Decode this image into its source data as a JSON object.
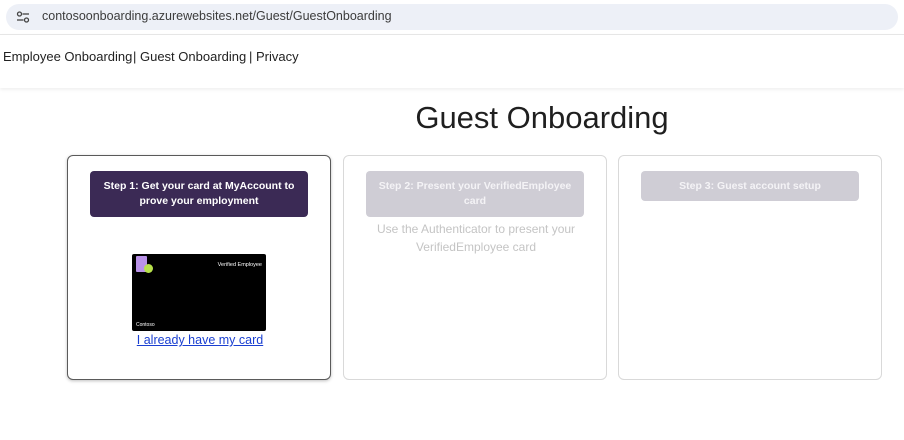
{
  "browser": {
    "url": "contosoonboarding.azurewebsites.net/Guest/GuestOnboarding",
    "site_info_icon": "tune-icon"
  },
  "nav": {
    "items": [
      {
        "label": "Employee Onboarding"
      },
      {
        "label": "| Guest Onboarding"
      },
      {
        "label": "| Privacy"
      }
    ]
  },
  "page": {
    "title": "Guest Onboarding"
  },
  "steps": [
    {
      "button_label": "Step 1: Get your card at MyAccount to prove your employment",
      "state": "active",
      "card": {
        "title": "Verified Employee",
        "issuer": "Contoso",
        "logo_color": "#b992e8",
        "dot_color": "#b7e04b"
      },
      "link_text": "I already have my card"
    },
    {
      "button_label": "Step 2: Present your VerifiedEmployee card",
      "state": "disabled",
      "description": "Use the Authenticator to present your VerifiedEmployee card"
    },
    {
      "button_label": "Step 3: Guest account setup",
      "state": "disabled"
    }
  ],
  "colors": {
    "active_button": "#3b2a55",
    "disabled_button": "#cfcdd5",
    "link": "#1a3fd1"
  }
}
